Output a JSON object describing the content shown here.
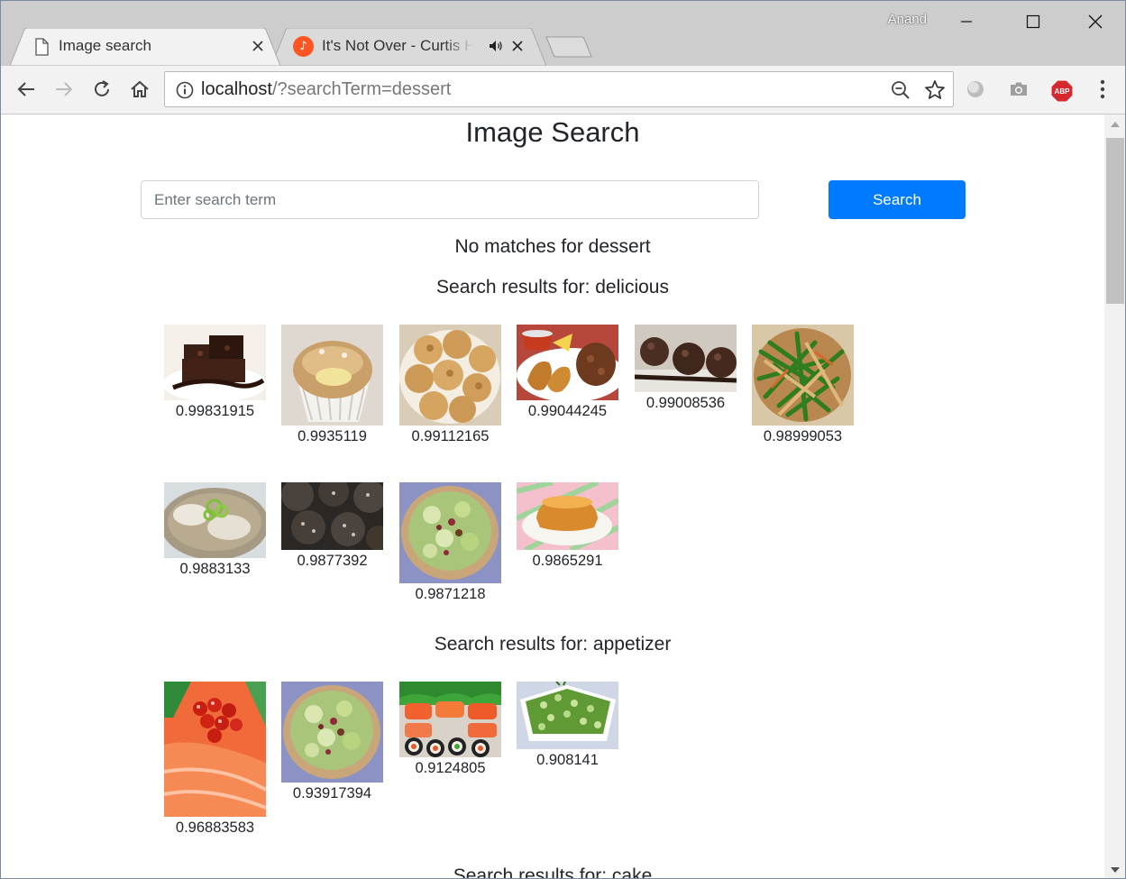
{
  "window": {
    "user": "Anand"
  },
  "tabs": [
    {
      "title": "Image search"
    },
    {
      "title": "It's Not Over - Curtis Harding"
    }
  ],
  "address": {
    "host": "localhost",
    "path": "/?searchTerm=dessert"
  },
  "page": {
    "title": "Image Search",
    "search_placeholder": "Enter search term",
    "search_value": "",
    "search_button": "Search",
    "no_match": "No matches for dessert"
  },
  "sections": [
    {
      "heading": "Search results for: delicious",
      "results": [
        {
          "score": "0.99831915",
          "image": "brownies"
        },
        {
          "score": "0.9935119",
          "image": "cream-puff"
        },
        {
          "score": "0.99112165",
          "image": "cookies"
        },
        {
          "score": "0.99044245",
          "image": "croquettes"
        },
        {
          "score": "0.99008536",
          "image": "meatballs"
        },
        {
          "score": "0.98999053",
          "image": "stir-fry"
        },
        {
          "score": "0.9883133",
          "image": "noodle-soup"
        },
        {
          "score": "0.9877392",
          "image": "energy-balls"
        },
        {
          "score": "0.9871218",
          "image": "salad-bowl"
        },
        {
          "score": "0.9865291",
          "image": "flan"
        }
      ]
    },
    {
      "heading": "Search results for: appetizer",
      "results": [
        {
          "score": "0.96883583",
          "image": "salmon-roe"
        },
        {
          "score": "0.93917394",
          "image": "salad-bowl"
        },
        {
          "score": "0.9124805",
          "image": "sushi-platter"
        },
        {
          "score": "0.908141",
          "image": "cucumber-salad"
        }
      ]
    },
    {
      "heading": "Search results for: cake",
      "results": []
    }
  ],
  "colors": {
    "accent": "#007bff",
    "tab_strip": "#cdcdcd",
    "toolbar": "#f2f2f2"
  }
}
